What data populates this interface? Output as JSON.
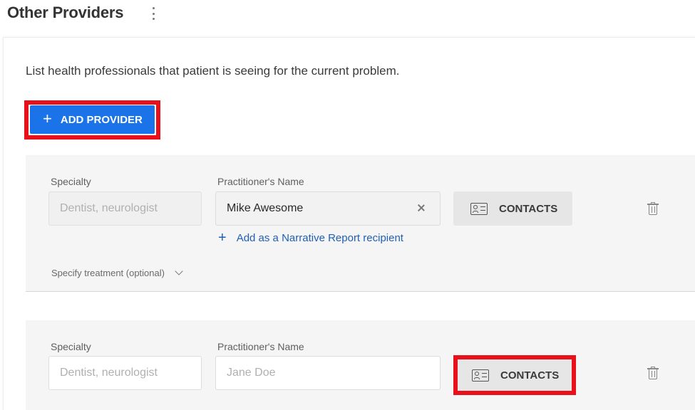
{
  "header": {
    "title": "Other Providers",
    "menu_icon": "more-vertical-icon"
  },
  "intro_text": "List health professionals that patient is seeing for the current problem.",
  "add_provider": {
    "label": "ADD PROVIDER",
    "icon": "plus-icon"
  },
  "providers": [
    {
      "specialty_label": "Specialty",
      "specialty_placeholder": "Dentist, neurologist",
      "name_label": "Practitioner's Name",
      "name_value": "Mike Awesome",
      "contacts_label": "CONTACTS",
      "narrative_link": "Add as a Narrative Report recipient",
      "specify_label": "Specify treatment (optional)"
    },
    {
      "specialty_label": "Specialty",
      "specialty_placeholder": "Dentist, neurologist",
      "name_label": "Practitioner's Name",
      "name_placeholder": "Jane Doe",
      "contacts_label": "CONTACTS"
    }
  ],
  "colors": {
    "primary": "#1a73e8",
    "highlight": "#e8101a",
    "link": "#1f5fb8"
  }
}
